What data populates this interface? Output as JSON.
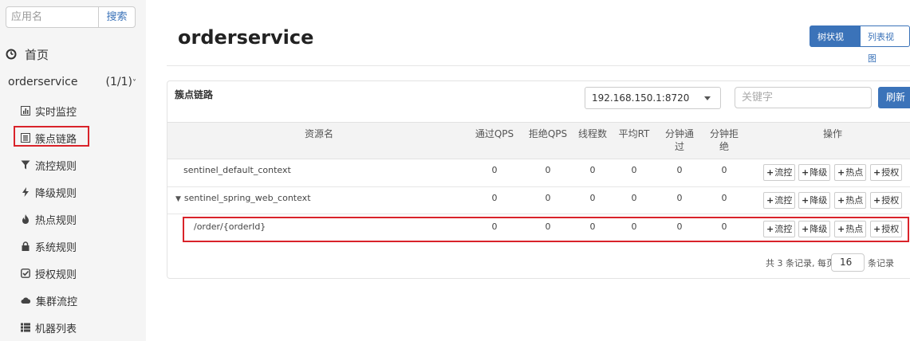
{
  "sidebar": {
    "search_placeholder": "应用名",
    "search_button": "搜索",
    "home": "首页",
    "app_name": "orderservice",
    "app_count": "(1/1)",
    "menu": [
      {
        "label": "实时监控",
        "icon": "bar-chart-icon"
      },
      {
        "label": "簇点链路",
        "icon": "list-icon"
      },
      {
        "label": "流控规则",
        "icon": "filter-icon"
      },
      {
        "label": "降级规则",
        "icon": "flash-icon"
      },
      {
        "label": "热点规则",
        "icon": "fire-icon"
      },
      {
        "label": "系统规则",
        "icon": "lock-icon"
      },
      {
        "label": "授权规则",
        "icon": "check-icon"
      },
      {
        "label": "集群流控",
        "icon": "cloud-icon"
      },
      {
        "label": "机器列表",
        "icon": "list-grid-icon"
      }
    ]
  },
  "main": {
    "title": "orderservice",
    "view_tree": "树状视图",
    "view_list": "列表视图",
    "panel_title": "簇点链路",
    "machine_selected": "192.168.150.1:8720",
    "keyword_placeholder": "关键字",
    "refresh": "刷新",
    "columns": {
      "resource": "资源名",
      "pass_qps": "通过QPS",
      "block_qps": "拒绝QPS",
      "threads": "线程数",
      "avg_rt": "平均RT",
      "minute_pass_1": "分钟通",
      "minute_pass_2": "过",
      "minute_block_1": "分钟拒",
      "minute_block_2": "绝",
      "ops": "操作"
    },
    "rows": [
      {
        "name": "sentinel_default_context",
        "pass_qps": "0",
        "block_qps": "0",
        "threads": "0",
        "avg_rt": "0",
        "minute_pass": "0",
        "minute_block": "0"
      },
      {
        "name": "sentinel_spring_web_context",
        "pass_qps": "0",
        "block_qps": "0",
        "threads": "0",
        "avg_rt": "0",
        "minute_pass": "0",
        "minute_block": "0"
      },
      {
        "name": "/order/{orderId}",
        "pass_qps": "0",
        "block_qps": "0",
        "threads": "0",
        "avg_rt": "0",
        "minute_pass": "0",
        "minute_block": "0"
      }
    ],
    "op_labels": {
      "flow": "流控",
      "degrade": "降级",
      "hot": "热点",
      "auth": "授权"
    },
    "pager": {
      "prefix": "共 3 条记录, 每页",
      "page_size": "16",
      "suffix": "条记录"
    }
  },
  "colors": {
    "accent": "#3b73b9",
    "highlight": "#d9232a"
  }
}
